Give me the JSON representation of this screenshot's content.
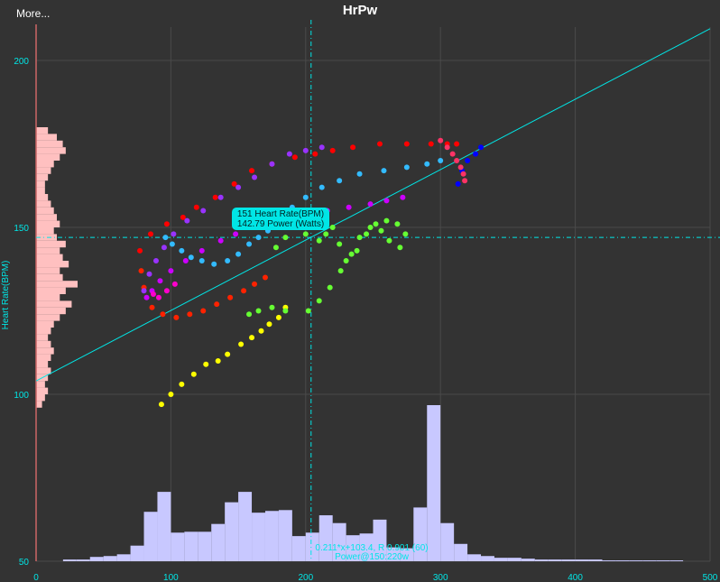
{
  "header": {
    "more_label": "More...",
    "title": "HrPw"
  },
  "colors": {
    "background": "#333333",
    "grid": "#4a4a4a",
    "axis_text": "#00e6e6",
    "fit_line": "#00e6e6",
    "hr_histogram": "#ffc0c0",
    "power_histogram": "#c8c8ff",
    "tooltip_bg": "#00e6e6",
    "y_axis_line": "#cc6666"
  },
  "chart_data": {
    "type": "scatter",
    "xlabel": "",
    "ylabel": "Heart Rate(BPM)",
    "xlim": [
      0,
      500
    ],
    "ylim": [
      50,
      210
    ],
    "x_ticks": [
      0,
      100,
      200,
      300,
      400,
      500
    ],
    "y_ticks": [
      50,
      100,
      150,
      200
    ],
    "grid": true,
    "crosshair": {
      "x": 204,
      "y": 147
    },
    "tooltip": {
      "line1": "151 Heart Rate(BPM)",
      "line2": "142.79 Power (Watts)",
      "x": 142.79,
      "y": 151
    },
    "fit": {
      "slope": 0.211,
      "intercept": 104,
      "label1": "0.211*x+103.4, R 0.901 (60)",
      "label2": "Power@150:220w"
    },
    "segments": [
      {
        "color": "#ffff00",
        "points": [
          [
            93,
            97
          ],
          [
            100,
            100
          ],
          [
            108,
            103
          ],
          [
            117,
            106
          ],
          [
            126,
            109
          ],
          [
            135,
            110
          ],
          [
            142,
            112
          ],
          [
            152,
            115
          ],
          [
            160,
            117
          ],
          [
            167,
            119
          ],
          [
            173,
            121
          ],
          [
            180,
            123
          ],
          [
            185,
            126
          ]
        ]
      },
      {
        "color": "#66ff33",
        "points": [
          [
            158,
            124
          ],
          [
            165,
            125
          ],
          [
            175,
            126
          ],
          [
            185,
            125
          ],
          [
            202,
            125
          ],
          [
            210,
            128
          ],
          [
            218,
            132
          ],
          [
            226,
            137
          ],
          [
            234,
            142
          ],
          [
            240,
            147
          ],
          [
            248,
            150
          ],
          [
            256,
            149
          ],
          [
            262,
            146
          ],
          [
            270,
            144
          ],
          [
            274,
            148
          ],
          [
            268,
            151
          ],
          [
            260,
            152
          ],
          [
            252,
            151
          ],
          [
            245,
            148
          ],
          [
            238,
            143
          ],
          [
            230,
            140
          ],
          [
            225,
            145
          ],
          [
            220,
            150
          ],
          [
            215,
            148
          ],
          [
            210,
            146
          ],
          [
            200,
            148
          ],
          [
            190,
            150
          ],
          [
            180,
            150
          ],
          [
            178,
            144
          ],
          [
            185,
            147
          ]
        ]
      },
      {
        "color": "#ff2200",
        "points": [
          [
            78,
            137
          ],
          [
            80,
            132
          ],
          [
            86,
            126
          ],
          [
            94,
            124
          ],
          [
            104,
            123
          ],
          [
            114,
            124
          ],
          [
            124,
            125
          ],
          [
            134,
            127
          ],
          [
            144,
            129
          ],
          [
            154,
            131
          ],
          [
            162,
            133
          ],
          [
            170,
            135
          ]
        ]
      },
      {
        "color": "#ff0000",
        "points": [
          [
            77,
            143
          ],
          [
            85,
            148
          ],
          [
            97,
            151
          ],
          [
            109,
            153
          ],
          [
            119,
            156
          ],
          [
            133,
            159
          ],
          [
            147,
            163
          ],
          [
            160,
            167
          ],
          [
            175,
            169
          ],
          [
            192,
            171
          ],
          [
            207,
            172
          ],
          [
            220,
            173
          ],
          [
            235,
            174
          ],
          [
            255,
            175
          ],
          [
            275,
            175
          ],
          [
            293,
            175
          ],
          [
            305,
            175
          ],
          [
            312,
            175
          ]
        ]
      },
      {
        "color": "#9933ff",
        "points": [
          [
            80,
            131
          ],
          [
            84,
            136
          ],
          [
            89,
            140
          ],
          [
            95,
            144
          ],
          [
            102,
            148
          ],
          [
            112,
            152
          ],
          [
            124,
            155
          ],
          [
            137,
            159
          ],
          [
            150,
            162
          ],
          [
            162,
            165
          ],
          [
            175,
            169
          ],
          [
            188,
            172
          ],
          [
            200,
            173
          ],
          [
            212,
            174
          ]
        ]
      },
      {
        "color": "#cc00ff",
        "points": [
          [
            82,
            129
          ],
          [
            86,
            131
          ],
          [
            92,
            134
          ],
          [
            100,
            137
          ],
          [
            111,
            140
          ],
          [
            123,
            143
          ],
          [
            137,
            146
          ],
          [
            148,
            148
          ],
          [
            160,
            150
          ],
          [
            172,
            151
          ],
          [
            186,
            153
          ],
          [
            200,
            154
          ],
          [
            216,
            155
          ],
          [
            232,
            156
          ],
          [
            248,
            157
          ],
          [
            260,
            158
          ],
          [
            272,
            159
          ]
        ]
      },
      {
        "color": "#ff00cc",
        "points": [
          [
            87,
            130
          ],
          [
            91,
            129
          ],
          [
            97,
            131
          ],
          [
            103,
            133
          ]
        ]
      },
      {
        "color": "#33bbff",
        "points": [
          [
            96,
            147
          ],
          [
            101,
            145
          ],
          [
            108,
            143
          ],
          [
            115,
            141
          ],
          [
            123,
            140
          ],
          [
            132,
            139
          ],
          [
            142,
            140
          ],
          [
            150,
            142
          ],
          [
            158,
            145
          ],
          [
            165,
            147
          ],
          [
            172,
            149
          ],
          [
            180,
            152
          ],
          [
            190,
            156
          ],
          [
            200,
            159
          ],
          [
            212,
            162
          ],
          [
            225,
            164
          ],
          [
            240,
            166
          ],
          [
            258,
            167
          ],
          [
            275,
            168
          ],
          [
            290,
            169
          ],
          [
            300,
            170
          ]
        ]
      },
      {
        "color": "#0000ff",
        "points": [
          [
            313,
            163
          ],
          [
            316,
            167
          ],
          [
            320,
            170
          ],
          [
            326,
            172
          ],
          [
            330,
            174
          ]
        ]
      },
      {
        "color": "#ff3366",
        "points": [
          [
            300,
            176
          ],
          [
            305,
            174
          ],
          [
            309,
            172
          ],
          [
            312,
            170
          ],
          [
            315,
            168
          ],
          [
            317,
            166
          ],
          [
            318,
            164
          ]
        ]
      }
    ],
    "hr_histogram": {
      "bin_width": 2,
      "bins": [
        [
          96,
          2
        ],
        [
          98,
          3
        ],
        [
          100,
          4
        ],
        [
          102,
          3
        ],
        [
          104,
          4
        ],
        [
          106,
          5
        ],
        [
          108,
          4
        ],
        [
          110,
          5
        ],
        [
          112,
          6
        ],
        [
          114,
          5
        ],
        [
          116,
          4
        ],
        [
          118,
          5
        ],
        [
          120,
          6
        ],
        [
          122,
          8
        ],
        [
          124,
          10
        ],
        [
          126,
          12
        ],
        [
          128,
          8
        ],
        [
          130,
          10
        ],
        [
          132,
          14
        ],
        [
          134,
          9
        ],
        [
          136,
          8
        ],
        [
          138,
          11
        ],
        [
          140,
          9
        ],
        [
          142,
          8
        ],
        [
          144,
          10
        ],
        [
          146,
          7
        ],
        [
          148,
          6
        ],
        [
          150,
          8
        ],
        [
          152,
          7
        ],
        [
          154,
          6
        ],
        [
          156,
          5
        ],
        [
          158,
          4
        ],
        [
          160,
          3
        ],
        [
          162,
          3
        ],
        [
          164,
          4
        ],
        [
          166,
          5
        ],
        [
          168,
          6
        ],
        [
          170,
          8
        ],
        [
          172,
          10
        ],
        [
          174,
          9
        ],
        [
          176,
          7
        ],
        [
          178,
          4
        ]
      ]
    },
    "power_histogram": {
      "bin_width": 10,
      "bins": [
        [
          20,
          2
        ],
        [
          30,
          2
        ],
        [
          40,
          5
        ],
        [
          50,
          6
        ],
        [
          60,
          8
        ],
        [
          70,
          18
        ],
        [
          80,
          57
        ],
        [
          90,
          80
        ],
        [
          100,
          33
        ],
        [
          110,
          34
        ],
        [
          120,
          34
        ],
        [
          130,
          43
        ],
        [
          140,
          68
        ],
        [
          150,
          80
        ],
        [
          160,
          56
        ],
        [
          170,
          58
        ],
        [
          180,
          59
        ],
        [
          190,
          29
        ],
        [
          200,
          33
        ],
        [
          210,
          53
        ],
        [
          220,
          44
        ],
        [
          230,
          30
        ],
        [
          240,
          32
        ],
        [
          250,
          48
        ],
        [
          260,
          16
        ],
        [
          270,
          15
        ],
        [
          280,
          62
        ],
        [
          290,
          180
        ],
        [
          300,
          44
        ],
        [
          310,
          20
        ],
        [
          320,
          8
        ],
        [
          330,
          6
        ],
        [
          340,
          4
        ],
        [
          350,
          4
        ],
        [
          360,
          3
        ],
        [
          370,
          2
        ],
        [
          380,
          2
        ],
        [
          390,
          2
        ],
        [
          400,
          2
        ],
        [
          410,
          2
        ],
        [
          420,
          1
        ],
        [
          430,
          1
        ],
        [
          440,
          1
        ],
        [
          450,
          1
        ],
        [
          460,
          1
        ],
        [
          470,
          1
        ]
      ]
    }
  }
}
